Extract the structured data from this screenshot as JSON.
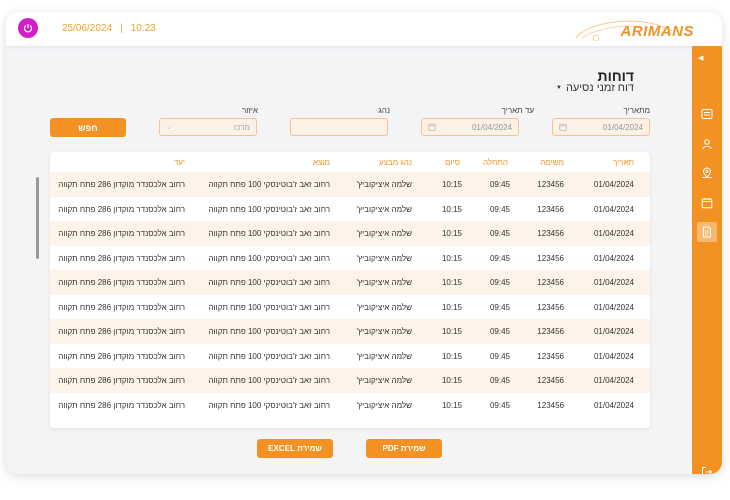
{
  "topbar": {
    "date": "25/06/2024",
    "separator": "|",
    "time": "10:23",
    "brand": "ARIMANS",
    "power_icon": "power-icon"
  },
  "page": {
    "title": "דוחות",
    "report_type": "דוח זמני נסיעה"
  },
  "filters": {
    "from_date": {
      "label": "מתאריך",
      "value": "01/04/2024"
    },
    "to_date": {
      "label": "עד תאריך",
      "value": "01/04/2024"
    },
    "driver": {
      "label": "נהג",
      "value": ""
    },
    "region": {
      "label": "איזור",
      "value": "מרכז"
    },
    "search_label": "חפש"
  },
  "table": {
    "headers": {
      "date": "תאריך",
      "task": "משימה",
      "start": "התחלה",
      "end": "סיום",
      "driver": "נהג מבצע",
      "origin": "מוצא",
      "destination": "יעד"
    },
    "rows": [
      {
        "date": "01/04/2024",
        "task": "123456",
        "start": "09:45",
        "end": "10:15",
        "driver": "שלמה איציקוביץ'",
        "origin": "רחוב זאב ז'בוטינסקי 100 פתח תקווה",
        "destination": "רחוב אלכסנדר מוקדון 286 פתח תקווה"
      },
      {
        "date": "01/04/2024",
        "task": "123456",
        "start": "09:45",
        "end": "10:15",
        "driver": "שלמה איציקוביץ'",
        "origin": "רחוב זאב ז'בוטינסקי 100 פתח תקווה",
        "destination": "רחוב אלכסנדר מוקדון 286 פתח תקווה"
      },
      {
        "date": "01/04/2024",
        "task": "123456",
        "start": "09:45",
        "end": "10:15",
        "driver": "שלמה איציקוביץ'",
        "origin": "רחוב זאב ז'בוטינסקי 100 פתח תקווה",
        "destination": "רחוב אלכסנדר מוקדון 286 פתח תקווה"
      },
      {
        "date": "01/04/2024",
        "task": "123456",
        "start": "09:45",
        "end": "10:15",
        "driver": "שלמה איציקוביץ'",
        "origin": "רחוב זאב ז'בוטינסקי 100 פתח תקווה",
        "destination": "רחוב אלכסנדר מוקדון 286 פתח תקווה"
      },
      {
        "date": "01/04/2024",
        "task": "123456",
        "start": "09:45",
        "end": "10:15",
        "driver": "שלמה איציקוביץ'",
        "origin": "רחוב זאב ז'בוטינסקי 100 פתח תקווה",
        "destination": "רחוב אלכסנדר מוקדון 286 פתח תקווה"
      },
      {
        "date": "01/04/2024",
        "task": "123456",
        "start": "09:45",
        "end": "10:15",
        "driver": "שלמה איציקוביץ'",
        "origin": "רחוב זאב ז'בוטינסקי 100 פתח תקווה",
        "destination": "רחוב אלכסנדר מוקדון 286 פתח תקווה"
      },
      {
        "date": "01/04/2024",
        "task": "123456",
        "start": "09:45",
        "end": "10:15",
        "driver": "שלמה איציקוביץ'",
        "origin": "רחוב זאב ז'בוטינסקי 100 פתח תקווה",
        "destination": "רחוב אלכסנדר מוקדון 286 פתח תקווה"
      },
      {
        "date": "01/04/2024",
        "task": "123456",
        "start": "09:45",
        "end": "10:15",
        "driver": "שלמה איציקוביץ'",
        "origin": "רחוב זאב ז'בוטינסקי 100 פתח תקווה",
        "destination": "רחוב אלכסנדר מוקדון 286 פתח תקווה"
      },
      {
        "date": "01/04/2024",
        "task": "123456",
        "start": "09:45",
        "end": "10:15",
        "driver": "שלמה איציקוביץ'",
        "origin": "רחוב זאב ז'בוטינסקי 100 פתח תקווה",
        "destination": "רחוב אלכסנדר מוקדון 286 פתח תקווה"
      },
      {
        "date": "01/04/2024",
        "task": "123456",
        "start": "09:45",
        "end": "10:15",
        "driver": "שלמה איציקוביץ'",
        "origin": "רחוב זאב ז'בוטינסקי 100 פתח תקווה",
        "destination": "רחוב אלכסנדר מוקדון 286 פתח תקווה"
      }
    ]
  },
  "actions": {
    "save_pdf": "שמירת PDF",
    "save_excel": "שמירת EXCEL"
  },
  "sidebar": {
    "items": [
      {
        "icon": "list-icon"
      },
      {
        "icon": "user-icon"
      },
      {
        "icon": "map-pin-icon"
      },
      {
        "icon": "calendar-icon"
      },
      {
        "icon": "report-icon",
        "active": true
      }
    ],
    "logout_icon": "logout-icon"
  },
  "colors": {
    "accent": "#f39222",
    "power": "#d21ec8",
    "row_shade": "#fdf3e8"
  }
}
